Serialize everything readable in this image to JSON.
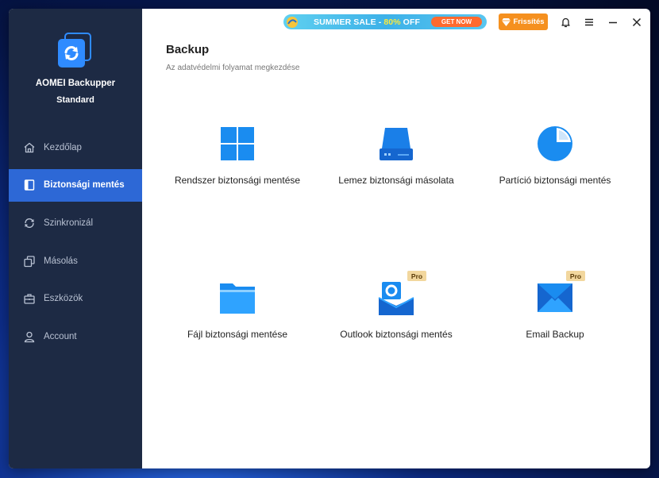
{
  "app": {
    "name": "AOMEI Backupper",
    "edition": "Standard"
  },
  "sidebar": {
    "items": [
      {
        "label": "Kezdőlap",
        "icon": "home-icon",
        "active": false
      },
      {
        "label": "Biztonsági mentés",
        "icon": "backup-icon",
        "active": true
      },
      {
        "label": "Szinkronizál",
        "icon": "sync-icon",
        "active": false
      },
      {
        "label": "Másolás",
        "icon": "clone-icon",
        "active": false
      },
      {
        "label": "Eszközök",
        "icon": "tools-icon",
        "active": false
      },
      {
        "label": "Account",
        "icon": "account-icon",
        "active": false
      }
    ]
  },
  "topbar": {
    "sale_text_prefix": "SUMMER SALE - ",
    "sale_percent": "80%",
    "sale_text_suffix": " OFF",
    "get_now": "GET NOW",
    "upgrade": "Frissítés"
  },
  "main": {
    "title": "Backup",
    "subtitle": "Az adatvédelmi folyamat megkezdése",
    "tiles": [
      {
        "label": "Rendszer biztonsági mentése",
        "icon": "windows-icon",
        "pro": ""
      },
      {
        "label": "Lemez biztonsági másolata",
        "icon": "disk-icon",
        "pro": ""
      },
      {
        "label": "Partíció biztonsági mentés",
        "icon": "partition-icon",
        "pro": ""
      },
      {
        "label": "Fájl biztonsági mentése",
        "icon": "folder-icon",
        "pro": ""
      },
      {
        "label": "Outlook biztonsági mentés",
        "icon": "outlook-icon",
        "pro": "Pro"
      },
      {
        "label": "Email Backup",
        "icon": "email-icon",
        "pro": "Pro"
      }
    ]
  },
  "colors": {
    "sidebar_bg": "#1d2a44",
    "active_bg": "#2d68d6",
    "accent": "#2f8bff",
    "upgrade_bg": "#f5901f"
  }
}
